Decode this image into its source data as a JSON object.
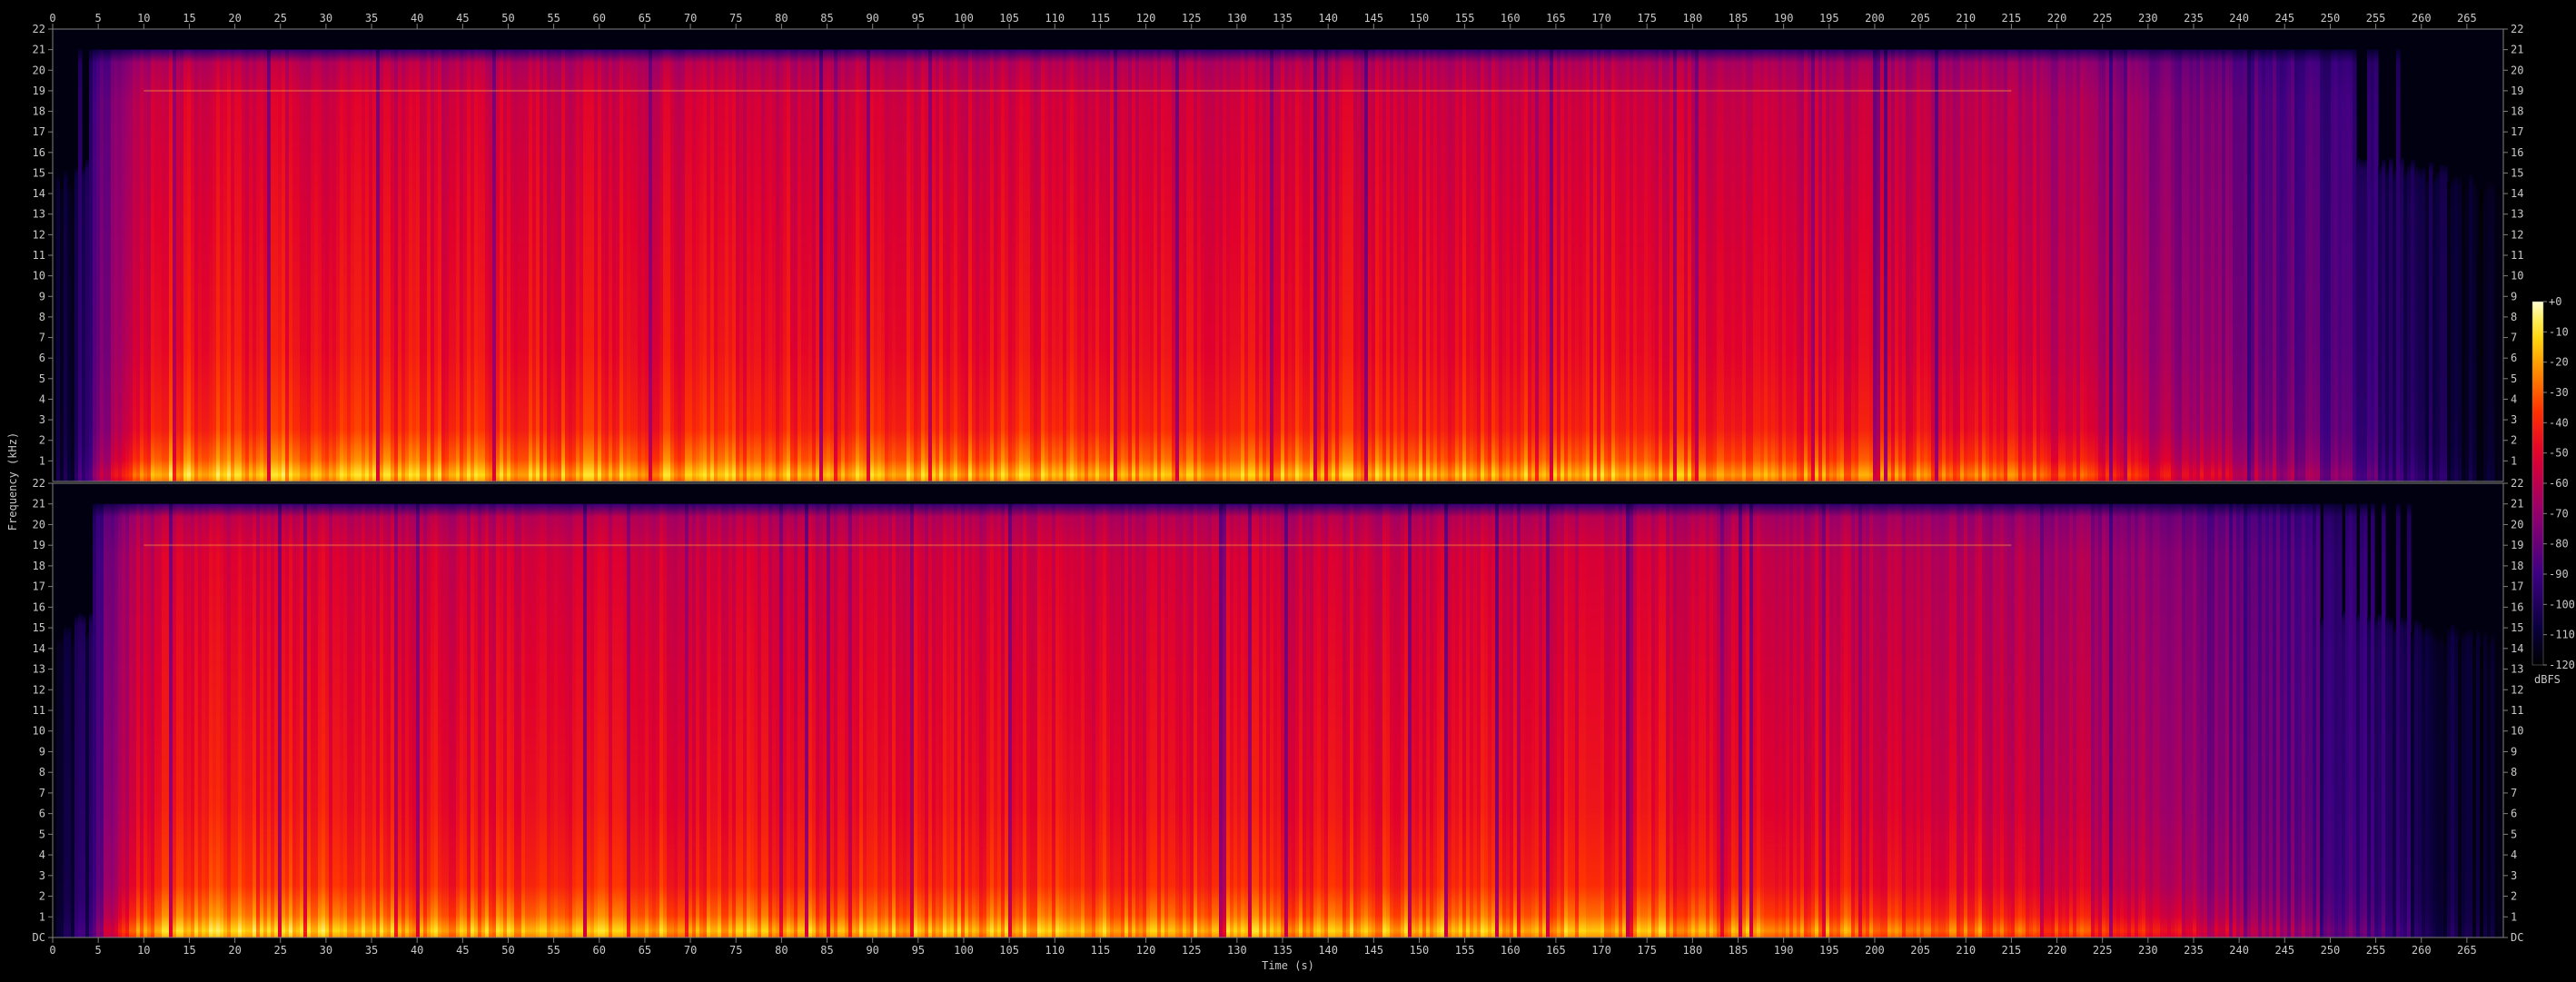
{
  "chart_data": {
    "type": "heatmap",
    "xlabel": "Time (s)",
    "ylabel": "Frequency (kHz)",
    "x_ticks": [
      0,
      5,
      10,
      15,
      20,
      25,
      30,
      35,
      40,
      45,
      50,
      55,
      60,
      65,
      70,
      75,
      80,
      85,
      90,
      95,
      100,
      105,
      110,
      115,
      120,
      125,
      130,
      135,
      140,
      145,
      150,
      155,
      160,
      165,
      170,
      175,
      180,
      185,
      190,
      195,
      200,
      205,
      210,
      215,
      220,
      225,
      230,
      235,
      240,
      245,
      250,
      255,
      260,
      265
    ],
    "x_range": [
      0,
      269
    ],
    "y_range": [
      0,
      22
    ],
    "y_ticks_upper": [
      "22",
      "21",
      "20",
      "19",
      "18",
      "17",
      "16",
      "15",
      "14",
      "13",
      "12",
      "11",
      "10",
      "9",
      "8",
      "7",
      "6",
      "5",
      "4",
      "3",
      "2",
      "1"
    ],
    "y_ticks_lower": [
      "22",
      "21",
      "20",
      "19",
      "18",
      "17",
      "16",
      "15",
      "14",
      "13",
      "12",
      "11",
      "10",
      "9",
      "8",
      "7",
      "6",
      "5",
      "4",
      "3",
      "2",
      "1",
      "DC"
    ],
    "channels": 2,
    "colorbar": {
      "label": "dBFS",
      "ticks": [
        "+0",
        "-10",
        "-20",
        "-30",
        "-40",
        "-50",
        "-60",
        "-70",
        "-80",
        "-90",
        "-100",
        "-110",
        "-120"
      ],
      "range": [
        -120,
        0
      ]
    },
    "colors": {
      "background": "#000000",
      "axis": "#7f7f7f",
      "text": "#c8c8c8",
      "colormap": [
        "#ffffff",
        "#fff5a0",
        "#ffd800",
        "#ff9600",
        "#ff3c00",
        "#e8002c",
        "#b4006e",
        "#7c0096",
        "#460090",
        "#1c0060",
        "#000020",
        "#000000"
      ]
    },
    "energy_profile": {
      "note_time_points": [
        0,
        3,
        6,
        9,
        12,
        20,
        40,
        60,
        80,
        100,
        120,
        140,
        160,
        180,
        200,
        215,
        225,
        235,
        242,
        248,
        252,
        256,
        260,
        264,
        267,
        269
      ],
      "level": [
        0.05,
        0.25,
        0.55,
        0.8,
        0.9,
        0.9,
        0.88,
        0.88,
        0.88,
        0.88,
        0.88,
        0.88,
        0.88,
        0.86,
        0.82,
        0.78,
        0.7,
        0.6,
        0.5,
        0.42,
        0.35,
        0.28,
        0.2,
        0.12,
        0.06,
        0.0
      ]
    }
  }
}
